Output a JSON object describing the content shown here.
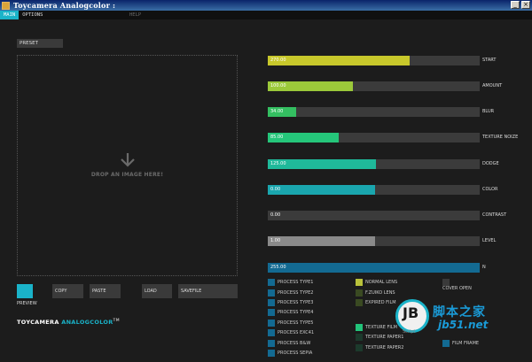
{
  "window": {
    "title": "Toycamera Analogcolor :"
  },
  "menu": [
    {
      "label": "MAIN",
      "active": true
    },
    {
      "label": "OPTIONS",
      "active": false
    },
    {
      "label": "HELP",
      "active": false
    }
  ],
  "preset_label": "PRESET",
  "dropzone_text": "DROP AN IMAGE HERE!",
  "preview_label": "PREVIEW",
  "actions": [
    "COPY",
    "PASTE",
    "LOAD",
    "SAVEFILE"
  ],
  "brand": {
    "part1": "TOYCAMERA",
    "part2": "ANALOGCOLOR",
    "tm": "TM"
  },
  "sliders": [
    {
      "label": "START",
      "value": "270.00",
      "fraction": 0.67,
      "color": "#c8c82b"
    },
    {
      "label": "AMOUNT",
      "value": "100.00",
      "fraction": 0.4,
      "color": "#9bc93a"
    },
    {
      "label": "BLUR",
      "value": "34.00",
      "fraction": 0.135,
      "color": "#34bf61"
    },
    {
      "label": "TEXTURE NOIZE",
      "value": "85.00",
      "fraction": 0.335,
      "color": "#25c67a"
    },
    {
      "label": "DODGE",
      "value": "125.00",
      "fraction": 0.51,
      "color": "#1fb99a"
    },
    {
      "label": "COLOR",
      "value": "0.00",
      "fraction": 0.505,
      "color": "#1aa6ae"
    },
    {
      "label": "CONTRAST",
      "value": "0.00",
      "fraction": 0.0,
      "color": "#1a8fb0"
    },
    {
      "label": "LEVEL",
      "value": "1.00",
      "fraction": 0.505,
      "color": "#8a8a8a"
    },
    {
      "label": "N",
      "value": "255.00",
      "fraction": 1.0,
      "color": "#136a92"
    }
  ],
  "process_types": [
    "PROCESS TYPE1",
    "PROCESS TYPE2",
    "PROCESS TYPE3",
    "PROCESS TYPE4",
    "PROCESS TYPE5",
    "PROCESS EXC41",
    "PROCESS B&W",
    "PROCESS SEPIA"
  ],
  "lenses": [
    {
      "label": "NORMAL LENS",
      "color": "#b9c23a"
    },
    {
      "label": "F.ZUIKO LENS",
      "color": "#3a4a22"
    },
    {
      "label": "EXPIRED FILM",
      "color": "#3a4a22"
    }
  ],
  "textures": [
    {
      "label": "TEXTURE FILM",
      "color": "#22c47a"
    },
    {
      "label": "TEXTURE PAPER1",
      "color": "#1c3a2c"
    },
    {
      "label": "TEXTURE PAPER2",
      "color": "#1c3a2c"
    }
  ],
  "cover_open": "COVER OPEN",
  "film_frame": "FILM FRAME",
  "watermark": {
    "letters": "JB",
    "script": "Script",
    "cn": "脚本之家",
    "url": "jb51.net"
  },
  "colors": {
    "accent": "#1ab3c9",
    "process_box": "#136a92",
    "cover_box": "#3a3a3a"
  }
}
